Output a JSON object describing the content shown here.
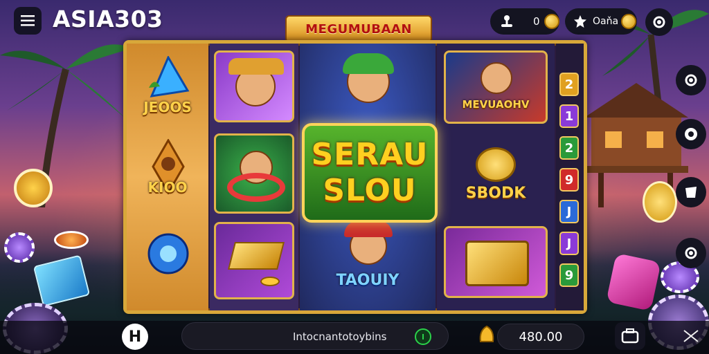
{
  "header": {
    "brand": "ASIA303",
    "coins_value": "0",
    "gems_label": "Oaňa",
    "menu_icon": "hamburger-menu-icon",
    "settings_icon": "gear-icon"
  },
  "game": {
    "title": "MEGUMUBAAN",
    "center_logo_line1": "SERAU",
    "center_logo_line2": "SLOU",
    "tiles": {
      "left_top": "JEOOS",
      "left_mid": "KIOO",
      "c3_top": "MEVUAOHV",
      "c3_mid": "SBODK",
      "c2_bottom": "TAOUIY"
    },
    "right_column_numbers": [
      "2",
      "1",
      "2",
      "9",
      "J",
      "J",
      "9"
    ]
  },
  "bottom": {
    "info_text": "Intocnantotoybins",
    "balance": "480.00",
    "hash_label": "H"
  },
  "colors": {
    "frame_gold": "#d8a83a",
    "accent_green": "#2bd24a",
    "panel_dark": "#141421"
  }
}
